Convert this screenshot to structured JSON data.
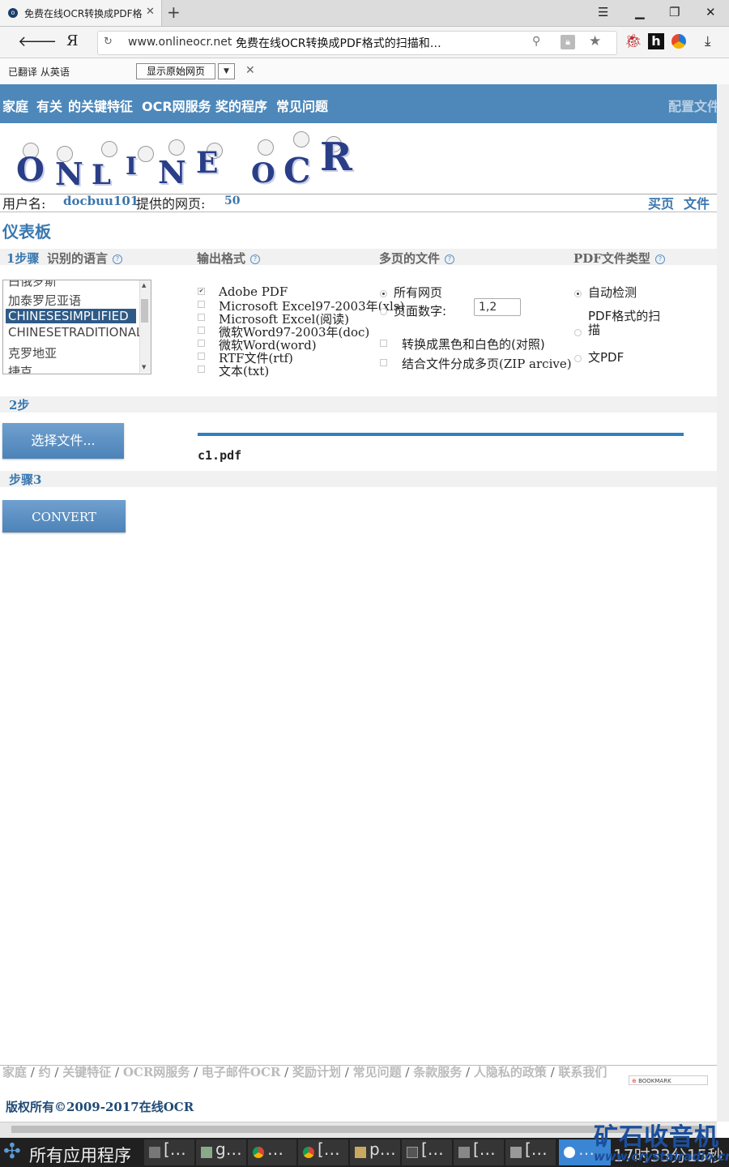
{
  "browser": {
    "tab_title": "免费在线OCR转换成PDF格式",
    "tab_favicon": "o",
    "new_tab": "+",
    "url_domain": "www.onlineocr.net",
    "url_title": "免费在线OCR转换成PDF格式的扫描和…",
    "yandex_logo": "Я",
    "ext_h": "h"
  },
  "translate_bar": {
    "status": "已翻译 从英语",
    "show_original": "显示原始网页"
  },
  "nav": {
    "items": [
      "家庭",
      "有关",
      "的关键特征",
      "OCR网服务",
      "奖的程序",
      "常见问题"
    ],
    "config": "配置文件"
  },
  "logo": {
    "word1": [
      "O",
      "N",
      "L",
      "I",
      "N",
      "E"
    ],
    "word2": [
      "O",
      "C",
      "R"
    ]
  },
  "user": {
    "username_label": "用户名:",
    "username": "docbuu101",
    "pages_label": "提供的网页:",
    "pages": "50",
    "buy": "买页",
    "files": "文件"
  },
  "dashboard_title": "仪表板",
  "step1": {
    "label": "1步骤",
    "languages_head": "识别的语言",
    "output_head": "输出格式",
    "multipage_head": "多页的文件",
    "pdftype_head": "PDF文件类型",
    "languages": [
      "白俄罗斯",
      "加泰罗尼亚语",
      "CHINESESIMPLIFIED",
      "CHINESETRADITIONAL",
      "克罗地亚",
      "捷克"
    ],
    "selected_language": "CHINESESIMPLIFIED",
    "formats": [
      {
        "label": "Adobe PDF",
        "checked": true
      },
      {
        "label": "Microsoft Excel97-2003年(xls)",
        "checked": false
      },
      {
        "label": "Microsoft Excel(阅读)",
        "checked": false
      },
      {
        "label": "微软Word97-2003年(doc)",
        "checked": false
      },
      {
        "label": "微软Word(word)",
        "checked": false
      },
      {
        "label": "RTF文件(rtf)",
        "checked": false
      },
      {
        "label": "文本(txt)",
        "checked": false
      }
    ],
    "all_pages": "所有网页",
    "page_numbers": "页面数字:",
    "page_numbers_value": "1,2",
    "convert_bw": "转换成黑色和白色的(对照)",
    "combine_zip": "结合文件分成多页(ZIP arcive)",
    "pdf_auto": "自动检测",
    "pdf_scan": "PDF格式的扫描",
    "pdf_text": "文PDF"
  },
  "step2": {
    "label": "2步",
    "choose_file": "选择文件...",
    "file_name": "c1.pdf",
    "upload_progress": 1.0
  },
  "step3": {
    "label": "步骤3",
    "convert": "CONVERT"
  },
  "footer": {
    "links": [
      "家庭",
      "约",
      "关键特征",
      "OCR网服务",
      "电子邮件OCR",
      "奖励计划",
      "常见问题",
      "条款服务",
      "人隐私的政策",
      "联系我们"
    ],
    "bookmark": "BOOKMARK",
    "copyright": "版权所有©2009-2017在线OCR"
  },
  "taskbar": {
    "start": "所有应用程序",
    "tasks": [
      "[…",
      "g…",
      "…",
      "[…",
      "p…",
      "[…",
      "[…",
      "[…",
      "…"
    ],
    "clock": "17时33分15秒"
  },
  "watermark": {
    "line1": "矿石收音机",
    "line2": "www.crystalradio.cn"
  },
  "colors": {
    "nav_bg": "#4e88ba",
    "link_blue": "#3a78b0",
    "button_blue": "#5a8fc2",
    "progress": "#2f7fc0"
  }
}
